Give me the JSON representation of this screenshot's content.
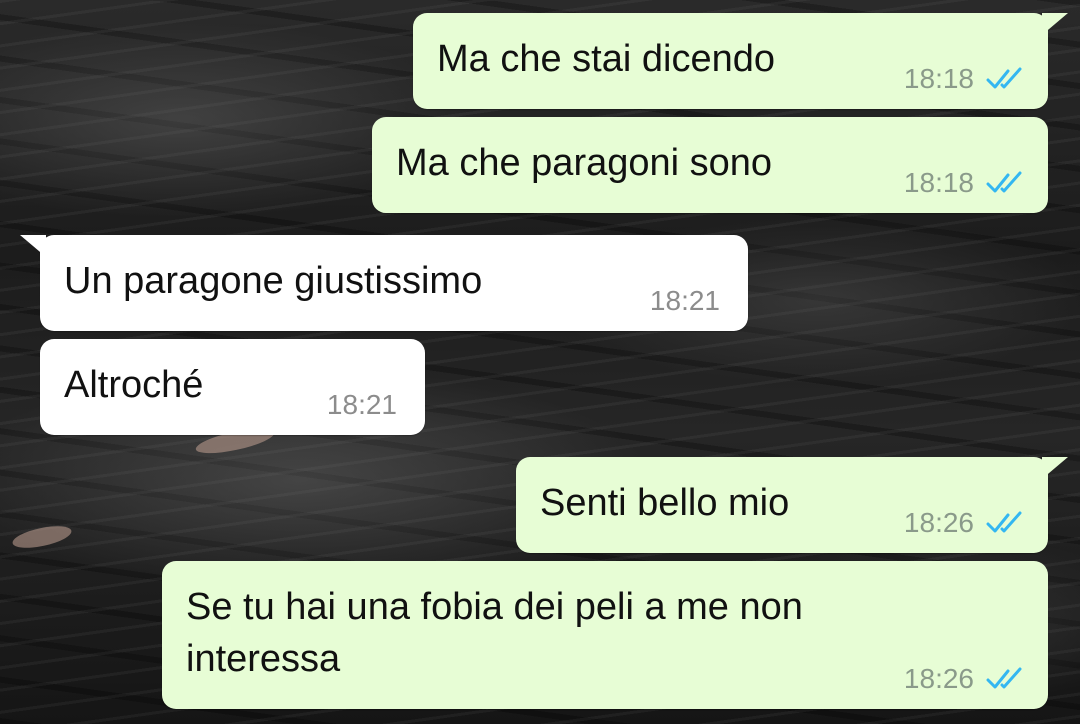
{
  "messages": [
    {
      "text": "Ma che stai dicendo",
      "time": "18:18",
      "direction": "outgoing",
      "status": "read"
    },
    {
      "text": "Ma che paragoni sono",
      "time": "18:18",
      "direction": "outgoing",
      "status": "read"
    },
    {
      "text": "Un paragone giustissimo",
      "time": "18:21",
      "direction": "incoming"
    },
    {
      "text": "Altroché",
      "time": "18:21",
      "direction": "incoming"
    },
    {
      "text": "Senti bello mio",
      "time": "18:26",
      "direction": "outgoing",
      "status": "read"
    },
    {
      "text": "Se tu hai una fobia dei peli a me non interessa",
      "time": "18:26",
      "direction": "outgoing",
      "status": "read"
    }
  ],
  "colors": {
    "outgoing_bubble": "#e7fdd5",
    "incoming_bubble": "#ffffff",
    "read_tick": "#34b7f1"
  },
  "icons": {
    "read_receipt": "double-check-icon"
  }
}
